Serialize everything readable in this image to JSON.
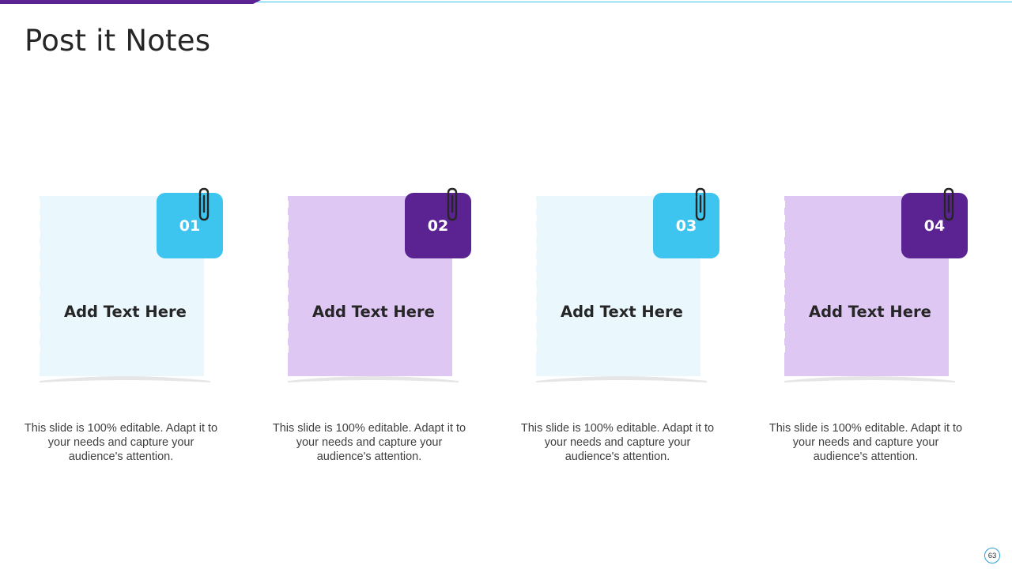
{
  "slide": {
    "title": "Post it Notes",
    "page_number": "63"
  },
  "colors": {
    "accent_purple": "#5b2292",
    "accent_blue": "#3dc4ef",
    "paper_blue": "#eaf7fc",
    "paper_purple": "#dec8f3"
  },
  "notes": [
    {
      "number": "01",
      "heading": "Add Text Here",
      "description": "This slide is 100% editable. Adapt it to your needs and capture your audience's attention.",
      "theme": "blue",
      "icon": "paperclip-icon"
    },
    {
      "number": "02",
      "heading": "Add Text Here",
      "description": "This slide is 100% editable. Adapt it to your needs and capture your audience's attention.",
      "theme": "purple",
      "icon": "paperclip-icon"
    },
    {
      "number": "03",
      "heading": "Add Text Here",
      "description": "This slide is 100% editable. Adapt it to your needs and capture your audience's attention.",
      "theme": "blue",
      "icon": "paperclip-icon"
    },
    {
      "number": "04",
      "heading": "Add Text Here",
      "description": "This slide is 100% editable. Adapt it to your needs and capture your audience's attention.",
      "theme": "purple",
      "icon": "paperclip-icon"
    }
  ]
}
